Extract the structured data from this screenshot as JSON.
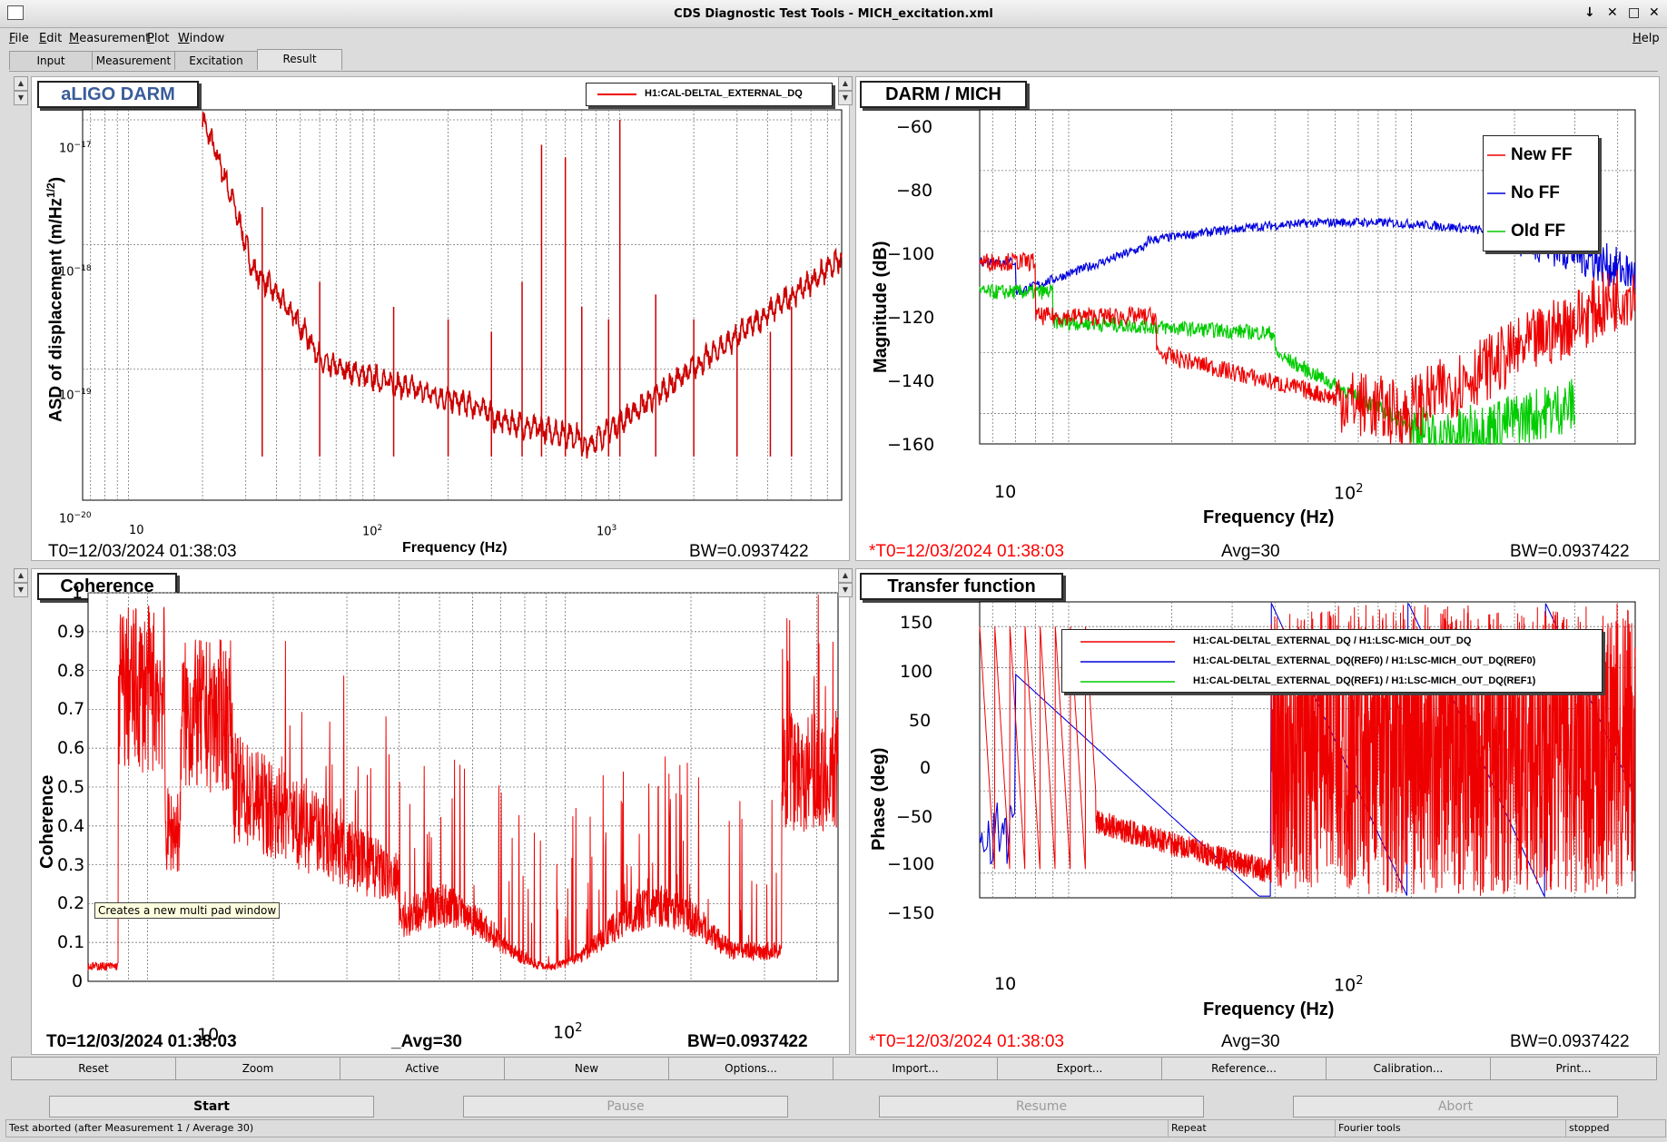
{
  "window": {
    "title": "CDS Diagnostic Test Tools - MICH_excitation.xml",
    "controls": [
      "↓",
      "✕",
      "□",
      "✕"
    ]
  },
  "menu": [
    "File",
    "Edit",
    "Measurement",
    "Plot",
    "Window"
  ],
  "help": "Help",
  "tabs": [
    "Input",
    "Measurement",
    "Excitation",
    "Result"
  ],
  "active_tab": "Result",
  "panels": {
    "darm": {
      "title": "aLIGO DARM",
      "legend": "H1:CAL-DELTAL_EXTERNAL_DQ",
      "ylabel": "ASD of displacement (m/Hz",
      "ylabel_sup": "1/2",
      "ylabel_close": ")",
      "xlabel": "Frequency (Hz)",
      "yticks": [
        "10",
        "10",
        "10",
        "10"
      ],
      "yexp": [
        "−17",
        "−18",
        "−19",
        "−20"
      ],
      "xticks": [
        "10",
        "10",
        "10"
      ],
      "xexp": [
        "",
        "2",
        "3"
      ],
      "t0": "T0=12/03/2024 01:38:03",
      "bw": "BW=0.0937422"
    },
    "ratio": {
      "title": "DARM / MICH",
      "ylabel": "Magnitude (dB)",
      "xlabel": "Frequency (Hz)",
      "yticks": [
        "−60",
        "−80",
        "−100",
        "−120",
        "−140",
        "−160"
      ],
      "xticks": [
        "10",
        "10"
      ],
      "xexp": [
        "",
        "2"
      ],
      "legend": [
        "New FF",
        "No FF",
        "Old FF"
      ],
      "t0": "*T0=12/03/2024 01:38:03",
      "avg": "Avg=30",
      "bw": "BW=0.0937422"
    },
    "coh": {
      "title": "Coherence",
      "ylabel": "Coherence",
      "yticks": [
        "1",
        "0.9",
        "0.8",
        "0.7",
        "0.6",
        "0.5",
        "0.4",
        "0.3",
        "0.2",
        "0.1",
        "0"
      ],
      "xticks": [
        "10",
        "10"
      ],
      "xexp": [
        "",
        "2"
      ],
      "t0": "T0=12/03/2024 01:38:03",
      "avg": "_Avg=30",
      "bw": "BW=0.0937422"
    },
    "tf": {
      "title": "Transfer function",
      "ylabel": "Phase (deg)",
      "xlabel": "Frequency (Hz)",
      "yticks": [
        "150",
        "100",
        "50",
        "0",
        "−50",
        "−100",
        "−150"
      ],
      "xticks": [
        "10",
        "10"
      ],
      "xexp": [
        "",
        "2"
      ],
      "legend": [
        "H1:CAL-DELTAL_EXTERNAL_DQ / H1:LSC-MICH_OUT_DQ",
        "H1:CAL-DELTAL_EXTERNAL_DQ(REF0) / H1:LSC-MICH_OUT_DQ(REF0)",
        "H1:CAL-DELTAL_EXTERNAL_DQ(REF1) / H1:LSC-MICH_OUT_DQ(REF1)"
      ],
      "t0": "*T0=12/03/2024 01:38:03",
      "avg": "Avg=30",
      "bw": "BW=0.0937422"
    }
  },
  "tooltip": "Creates a new multi pad window",
  "buttons": [
    "Reset",
    "Zoom",
    "Active",
    "New",
    "Options...",
    "Import...",
    "Export...",
    "Reference...",
    "Calibration...",
    "Print..."
  ],
  "controls": [
    "Start",
    "Pause",
    "Resume",
    "Abort"
  ],
  "status": [
    "Test aborted (after Measurement 1 / Average 30)",
    "Repeat",
    "Fourier tools",
    "stopped"
  ],
  "colors": {
    "red": "#ee0000",
    "blue": "#0000dd",
    "green": "#00cc00"
  }
}
